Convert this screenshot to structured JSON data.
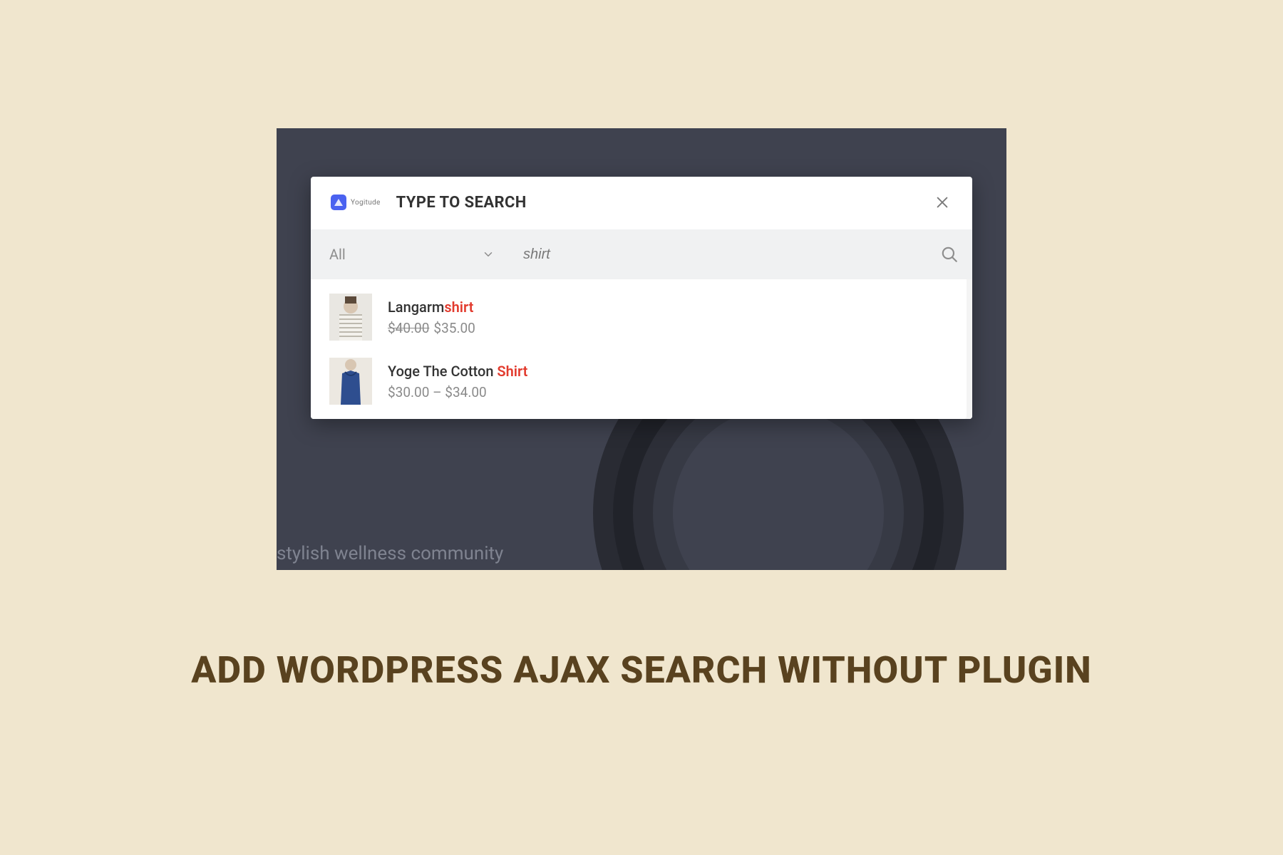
{
  "background": {
    "tagline": "stylish wellness community"
  },
  "modal": {
    "logo_text": "Yogitude",
    "title": "TYPE TO SEARCH",
    "category": {
      "selected": "All"
    },
    "search": {
      "value": "shirt"
    }
  },
  "results": [
    {
      "title_prefix": "Langarm",
      "title_highlight": "shirt",
      "title_suffix": "",
      "old_price": "$40.00",
      "price": "$35.00",
      "thumb": "striped-top"
    },
    {
      "title_prefix": "Yoge The Cotton ",
      "title_highlight": "Shirt",
      "title_suffix": "",
      "price": "$30.00 – $34.00",
      "thumb": "blue-cami"
    }
  ],
  "headline": "ADD WORDPRESS AJAX SEARCH WITHOUT PLUGIN"
}
